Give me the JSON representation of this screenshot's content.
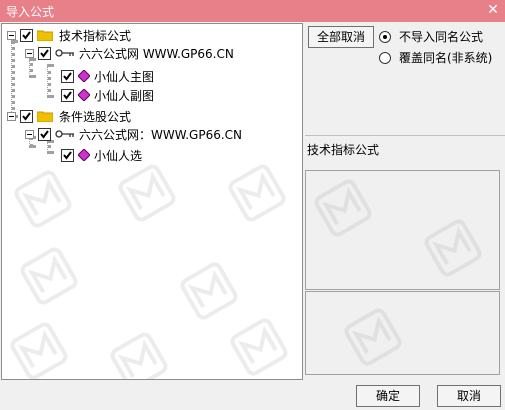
{
  "window": {
    "title": "导入公式",
    "close": "✕"
  },
  "tree": {
    "nodes": [
      {
        "label": "技术指标公式"
      },
      {
        "label": "六六公式网 WWW.GP66.CN"
      },
      {
        "label": "小仙人主图"
      },
      {
        "label": "小仙人副图"
      },
      {
        "label": "条件选股公式"
      },
      {
        "label": "六六公式网：WWW.GP66.CN"
      },
      {
        "label": "小仙人选"
      }
    ]
  },
  "right": {
    "deselect_all": "全部取消",
    "radio_options": [
      {
        "label": "不导入同名公式",
        "selected": true
      },
      {
        "label": "覆盖同名(非系统)",
        "selected": false
      }
    ],
    "formula_label": "技术指标公式"
  },
  "buttons": {
    "ok": "确定",
    "cancel": "取消"
  },
  "colors": {
    "titlebar": "#e8808a",
    "diamond": "#cc33cc",
    "folder": "#f0c000"
  }
}
